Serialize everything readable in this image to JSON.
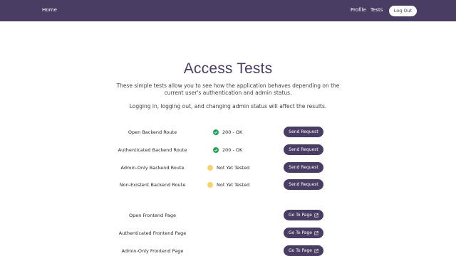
{
  "nav": {
    "home": "Home",
    "profile": "Profile",
    "tests": "Tests",
    "logout": "Log Out"
  },
  "page": {
    "title": "Access Tests",
    "intro": "These simple tests allow you to see how the application behaves depending on the current user's authentication and admin status.",
    "note": "Logging in, logging out, and changing admin status will affect the results."
  },
  "backend_tests": [
    {
      "label": "Open Backend Route",
      "status": "200 - OK",
      "state": "ok",
      "action": "Send Request"
    },
    {
      "label": "Authenticated Backend Route",
      "status": "200 - OK",
      "state": "ok",
      "action": "Send Request"
    },
    {
      "label": "Admin-Only Backend Route",
      "status": "Not Yet Tested",
      "state": "pending",
      "action": "Send Request"
    },
    {
      "label": "Non-Existent Backend Route",
      "status": "Not Yet Tested",
      "state": "pending",
      "action": "Send Request"
    }
  ],
  "frontend_tests": [
    {
      "label": "Open Frontend Page",
      "action": "Go To Page"
    },
    {
      "label": "Authenticated Frontend Page",
      "action": "Go To Page"
    },
    {
      "label": "Admin-Only Frontend Page",
      "action": "Go To Page"
    }
  ],
  "colors": {
    "brand": "#4a3d63",
    "ok": "#22a35a",
    "pending": "#f5d36b"
  },
  "icons": {
    "ok": "check-circle-icon",
    "pending": "dot-icon",
    "external": "external-link-icon"
  }
}
